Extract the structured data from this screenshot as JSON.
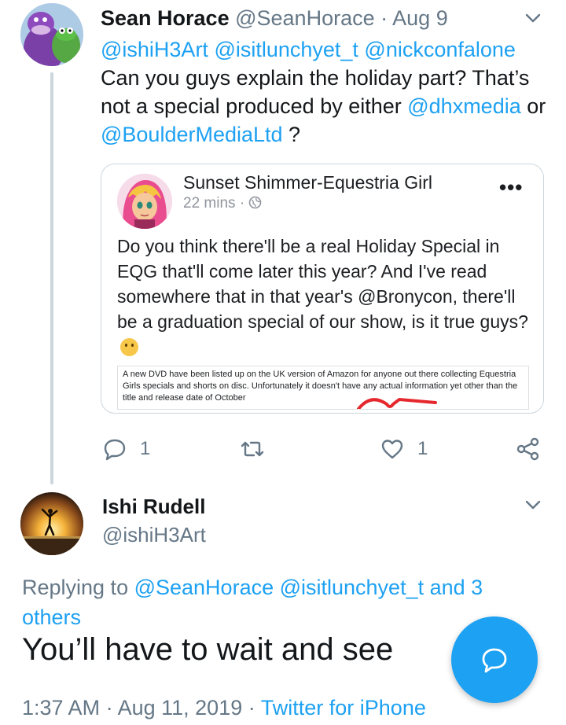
{
  "tweet1": {
    "author_name": "Sean Horace",
    "author_handle": "@SeanHorace",
    "separator": "·",
    "date": "Aug 9",
    "mentions": "@ishiH3Art @isitlunchyet_t @nickconfalone",
    "body_part1": "Can you guys explain the holiday part? That’s not a special produced by either ",
    "link1": "@dhxmedia",
    "body_part2": " or ",
    "link2": "@BoulderMediaLtd",
    "body_part3": " ?",
    "quote": {
      "author": "Sunset Shimmer-Equestria Girl",
      "time": "22 mins",
      "meta_sep": "·",
      "more": "•••",
      "text": "Do you think there'll be a real Holiday Special in EQG that'll come later this year? And I've read somewhere that in that year's @Bronycon, there'll be a graduation special of our show, is it true guys?",
      "embed_text": "A new DVD have been listed up on the UK version of Amazon for anyone out there collecting Equestria Girls specials and shorts on disc. Unfortunately  it doesn't have any actual information yet other than the title and release date of October"
    },
    "actions": {
      "reply_count": "1",
      "like_count": "1"
    }
  },
  "tweet2": {
    "author_name": "Ishi Rudell",
    "author_handle": "@ishiH3Art",
    "replying_prefix": "Replying to ",
    "replying_users": "@SeanHorace @isitlunchyet_t and 3 others",
    "body": "You’ll have to wait and see",
    "time": "1:37 AM",
    "sep1": "·",
    "date": "Aug 11, 2019",
    "sep2": "·",
    "source": "Twitter for iPhone"
  },
  "icons": {
    "tweet_menu": "chevron-down-icon",
    "reply": "reply-icon",
    "retweet": "retweet-icon",
    "like": "heart-icon",
    "share": "share-icon",
    "compose": "compose-reply-icon",
    "globe": "globe-icon"
  },
  "colors": {
    "accent": "#1da1f2",
    "muted": "#657786",
    "text": "#14171a",
    "thread_line": "#ccd6dd"
  }
}
